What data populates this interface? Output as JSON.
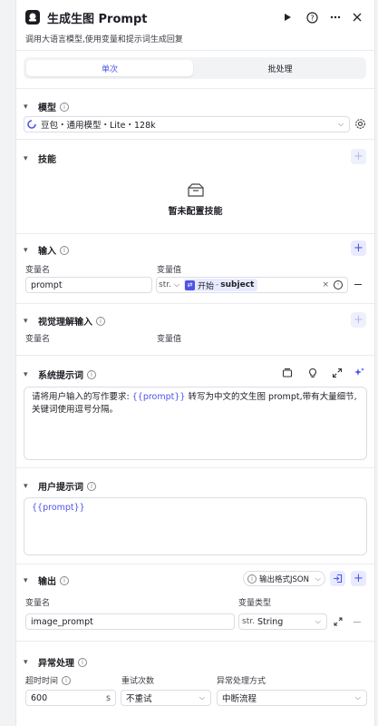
{
  "header": {
    "title": "生成生图 Prompt",
    "description": "调用大语言模型,使用变量和提示词生成回复"
  },
  "tabs": [
    {
      "label": "单次",
      "active": true
    },
    {
      "label": "批处理",
      "active": false
    }
  ],
  "model": {
    "title": "模型",
    "value": "豆包・通用模型・Lite・128k"
  },
  "skills": {
    "title": "技能",
    "empty": "暂未配置技能"
  },
  "input": {
    "title": "输入",
    "col_name": "变量名",
    "col_value": "变量值",
    "rows": [
      {
        "name": "prompt",
        "type": "str.",
        "ref_node": "开始",
        "ref_sep": "-",
        "ref_var": "subject"
      }
    ]
  },
  "visual_input": {
    "title": "视觉理解输入",
    "col_name": "变量名",
    "col_value": "变量值"
  },
  "system_prompt": {
    "title": "系统提示词",
    "text_before": "请将用户输入的写作要求:",
    "var": "{{prompt}}",
    "text_after": "转写为中文的文生图 prompt,带有大量细节,关键词使用逗号分隔。"
  },
  "user_prompt": {
    "title": "用户提示词",
    "var": "{{prompt}}"
  },
  "output": {
    "title": "输出",
    "format": "输出格式JSON",
    "col_name": "变量名",
    "col_type": "变量类型",
    "rows": [
      {
        "name": "image_prompt",
        "type_prefix": "str.",
        "type": "String"
      }
    ]
  },
  "error": {
    "title": "异常处理",
    "timeout_label": "超时时间",
    "timeout_value": "600",
    "timeout_unit": "s",
    "retry_label": "重试次数",
    "retry_value": "不重试",
    "mode_label": "异常处理方式",
    "mode_value": "中断流程"
  },
  "colors": {
    "accent": "#4d53e8",
    "border": "#dcdde3",
    "panel_bg": "#ffffff",
    "page_bg": "#f2f3f5"
  }
}
